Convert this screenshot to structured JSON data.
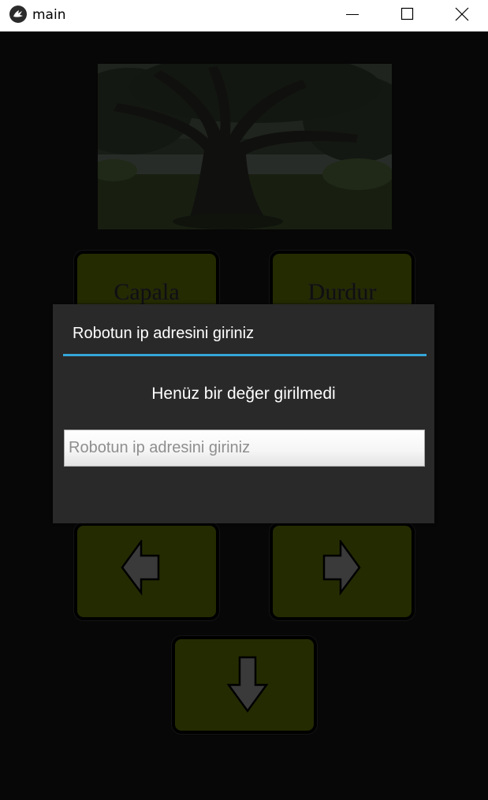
{
  "window": {
    "title": "main"
  },
  "controls": {
    "anchor_label": "Capala",
    "stop_label": "Durdur"
  },
  "dialog": {
    "title": "Robotun ip adresini giriniz",
    "message": "Henüz bir değer girilmedi",
    "input": {
      "value": "",
      "placeholder": "Robotun ip adresini giriniz"
    }
  },
  "icons": {
    "app": "kivy-logo-icon",
    "minimize": "minimize-icon",
    "maximize": "maximize-icon",
    "close": "close-icon",
    "left": "arrow-left-icon",
    "right": "arrow-right-icon",
    "down": "arrow-down-icon"
  },
  "colors": {
    "button_fill": "#434f03",
    "dialog_bg": "#292929",
    "accent": "#35a7d9",
    "background": "#0d0d0d"
  }
}
